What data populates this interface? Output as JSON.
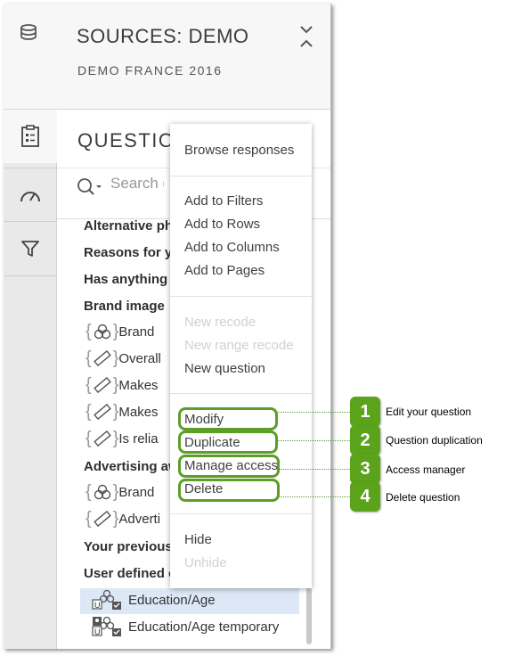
{
  "header": {
    "title": "SOURCES: DEMO",
    "subtitle": "DEMO FRANCE 2016"
  },
  "questions": {
    "title": "QUESTIO",
    "search_placeholder": "Search q",
    "items": [
      "Alternative ph",
      "Reasons for yo",
      "Has anything g",
      "Brand image",
      "Brand",
      "Overall",
      "Makes",
      "Makes",
      "Is relia",
      "Advertising aw",
      "Brand",
      "Adverti",
      "Your previous",
      "User defined c",
      "Education/Age",
      "Education/Age temporary"
    ]
  },
  "menu": {
    "browse": "Browse responses",
    "add_filters": "Add to Filters",
    "add_rows": "Add to Rows",
    "add_columns": "Add to Columns",
    "add_pages": "Add to Pages",
    "new_recode": "New recode",
    "new_range_recode": "New range recode",
    "new_question": "New question",
    "modify": "Modify",
    "duplicate": "Duplicate",
    "manage_access": "Manage access",
    "delete": "Delete",
    "hide": "Hide",
    "unhide": "Unhide"
  },
  "callouts": [
    {
      "num": "1",
      "text": "Edit your question"
    },
    {
      "num": "2",
      "text": "Question duplication"
    },
    {
      "num": "3",
      "text": "Access manager"
    },
    {
      "num": "4",
      "text": "Delete question"
    }
  ],
  "colors": {
    "accent_green": "#5aa31b",
    "highlight": "#dde8f7"
  }
}
